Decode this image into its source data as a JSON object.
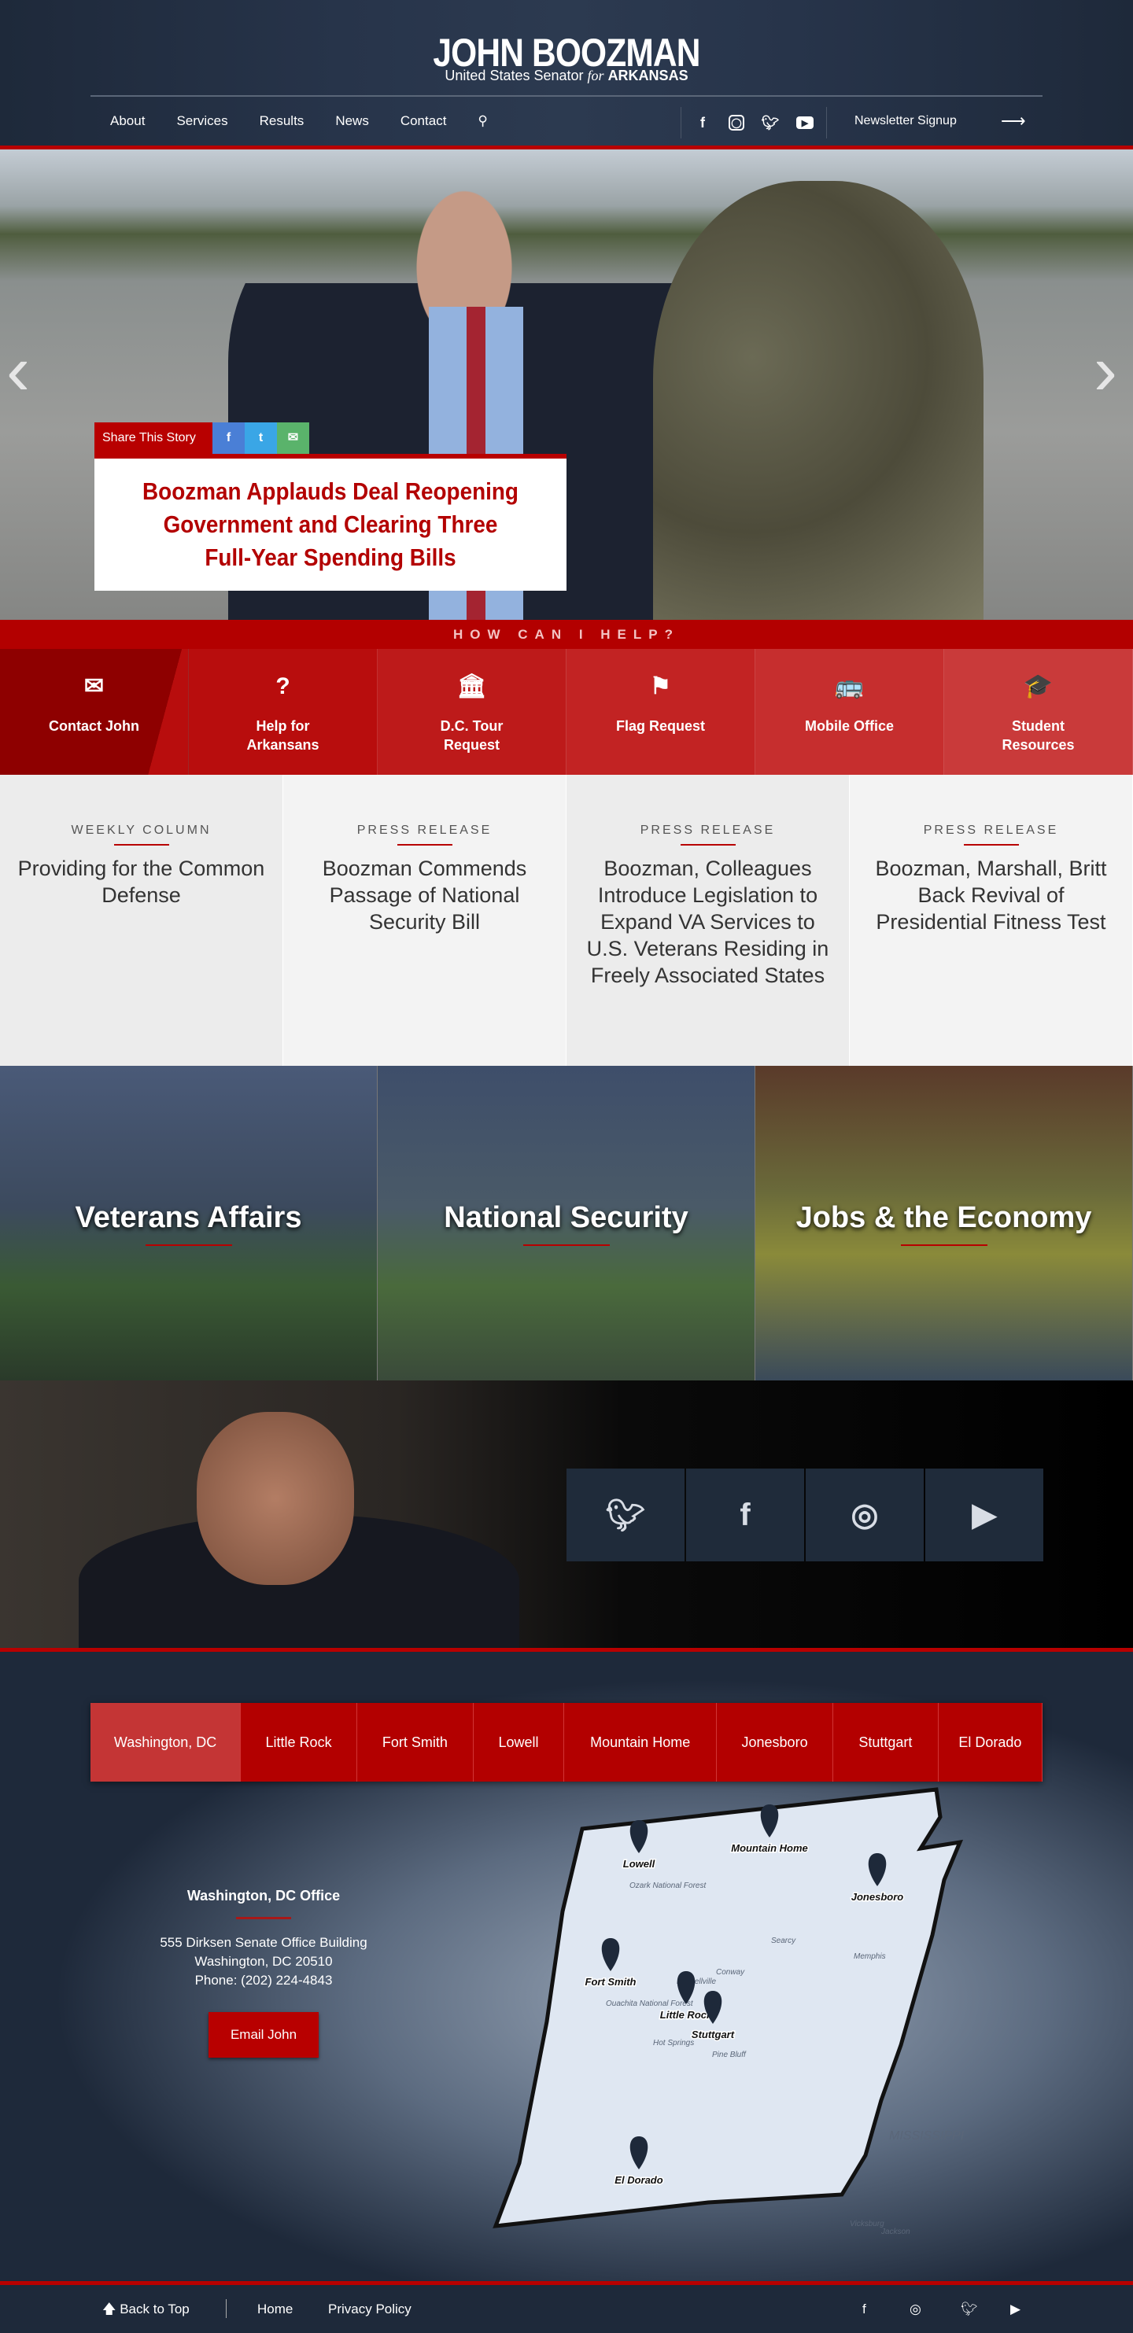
{
  "header": {
    "title": "JOHN BOOZMAN",
    "subtitle_prefix": "United States Senator",
    "subtitle_for": "for",
    "subtitle_state": "ARKANSAS",
    "nav": [
      "About",
      "Services",
      "Results",
      "News",
      "Contact"
    ],
    "newsletter": "Newsletter Signup"
  },
  "hero": {
    "share_label": "Share This Story",
    "headline": "Boozman Applauds Deal Reopening Government and Clearing Three Full-Year Spending Bills"
  },
  "help": {
    "title": "HOW CAN I HELP?",
    "tiles": [
      {
        "label": "Contact John",
        "icon": "✉"
      },
      {
        "label": "Help for Arkansans",
        "icon": "?"
      },
      {
        "label": "D.C. Tour Request",
        "icon": "🏛"
      },
      {
        "label": "Flag Request",
        "icon": "⚑"
      },
      {
        "label": "Mobile Office",
        "icon": "🚌"
      },
      {
        "label": "Student Resources",
        "icon": "🎓"
      }
    ],
    "colors": [
      "#8e0000",
      "#b80d0d",
      "#bd1a1a",
      "#c22323",
      "#c62e2e",
      "#c93a3a"
    ]
  },
  "press": [
    {
      "category": "WEEKLY COLUMN",
      "title": "Providing for the Common Defense"
    },
    {
      "category": "PRESS RELEASE",
      "title": "Boozman Commends Passage of National Security Bill"
    },
    {
      "category": "PRESS RELEASE",
      "title": "Boozman, Colleagues Introduce Legislation to Expand VA Services to U.S. Veterans Residing in Freely Associated States"
    },
    {
      "category": "PRESS RELEASE",
      "title": "Boozman, Marshall, Britt Back Revival of Presidential Fitness Test"
    }
  ],
  "issues": [
    "Veterans Affairs",
    "National Security",
    "Jobs & the Economy"
  ],
  "offices": {
    "tabs": [
      "Washington, DC",
      "Little Rock",
      "Fort Smith",
      "Lowell",
      "Mountain Home",
      "Jonesboro",
      "Stuttgart",
      "El Dorado"
    ],
    "active": 0,
    "title": "Washington, DC Office",
    "address1": "555 Dirksen Senate Office Building",
    "address2": "Washington, DC 20510",
    "phone": "Phone: (202) 224-4843",
    "button": "Email John",
    "map_pins": [
      "Lowell",
      "Mountain Home",
      "Jonesboro",
      "Fort Smith",
      "Little Rock",
      "Stuttgart",
      "El Dorado"
    ],
    "map_labels": [
      "Ozark National Forest",
      "Ouachita National Forest",
      "Searcy",
      "Conway",
      "Russellville",
      "Hot Springs",
      "Pine Bluff",
      "Memphis",
      "MISSISSIPPI",
      "Vicksburg",
      "Jackson"
    ]
  },
  "footer": {
    "back_to_top": "Back to Top",
    "home": "Home",
    "privacy": "Privacy Policy"
  }
}
